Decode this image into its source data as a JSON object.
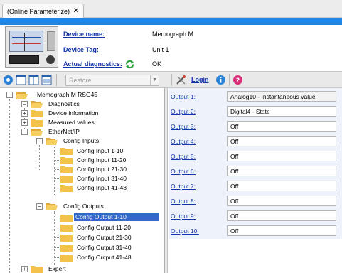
{
  "tab": {
    "title": "(Online Parameterize)",
    "close": "✕"
  },
  "header": {
    "device_name_label": "Device name:",
    "device_name_value": "Memograph M",
    "device_tag_label": "Device Tag:",
    "device_tag_value": "Unit 1",
    "diagnostics_label": "Actual diagnostics:",
    "diagnostics_value": "OK"
  },
  "toolbar": {
    "restore_placeholder": "Restore",
    "login_label": "Login"
  },
  "tree": {
    "nodes": [
      {
        "label": "Memograph M RSG45"
      },
      {
        "label": "Diagnostics"
      },
      {
        "label": "Device information"
      },
      {
        "label": "Measured values"
      },
      {
        "label": "EtherNet/IP"
      },
      {
        "label": "Config Inputs"
      },
      {
        "label": "Config Input 1-10"
      },
      {
        "label": "Config Input 11-20"
      },
      {
        "label": "Config Input 21-30"
      },
      {
        "label": "Config Input 31-40"
      },
      {
        "label": "Config Input 41-48"
      },
      {
        "label": "Config Outputs"
      },
      {
        "label": "Config Output 1-10"
      },
      {
        "label": "Config Output 11-20"
      },
      {
        "label": "Config Output 21-30"
      },
      {
        "label": "Config Output 31-40"
      },
      {
        "label": "Config Output 41-48"
      },
      {
        "label": "Expert"
      }
    ],
    "selected": "Config Output 1-10"
  },
  "outputs": [
    {
      "label": "Output 1:",
      "value": "Analog10 - Instantaneous value"
    },
    {
      "label": "Output 2:",
      "value": "Digital4 - State"
    },
    {
      "label": "Output 3:",
      "value": "Off"
    },
    {
      "label": "Output 4:",
      "value": "Off"
    },
    {
      "label": "Output 5:",
      "value": "Off"
    },
    {
      "label": "Output 6:",
      "value": "Off"
    },
    {
      "label": "Output 7:",
      "value": "Off"
    },
    {
      "label": "Output 8:",
      "value": "Off"
    },
    {
      "label": "Output 9:",
      "value": "Off"
    },
    {
      "label": "Output 10:",
      "value": "Off"
    }
  ],
  "colors": {
    "accent": "#1f86e6",
    "link": "#1336a8",
    "selection": "#3269c6",
    "folder": "#f2c24a"
  },
  "icons": {
    "refresh": "refresh-icon",
    "help": "help-icon",
    "tree_folder": "folder-icon"
  }
}
